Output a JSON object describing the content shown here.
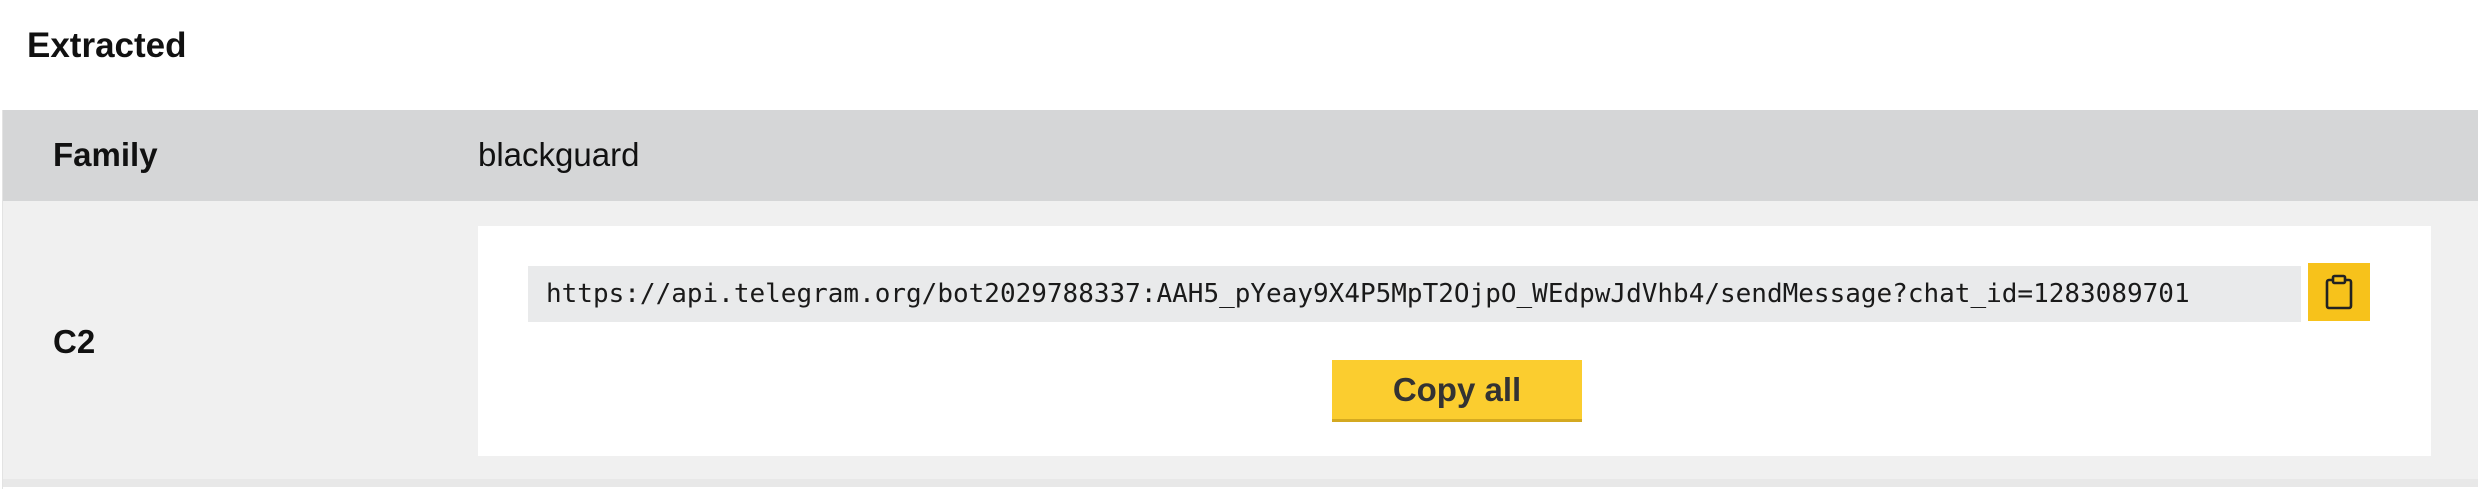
{
  "section": {
    "title": "Extracted"
  },
  "rows": [
    {
      "key": "Family",
      "value": "blackguard"
    },
    {
      "key": "C2",
      "values": [
        "https://api.telegram.org/bot2029788337:AAH5_pYeay9X4P5MpT2OjpO_WEdpwJdVhb4/sendMessage?chat_id=1283089701"
      ]
    }
  ],
  "actions": {
    "copy_all_label": "Copy all",
    "copy_icon": "clipboard-icon"
  },
  "colors": {
    "accent": "#fbcd2f",
    "family_row_bg": "#d5d6d7",
    "c2_row_bg": "#f0f0f0",
    "url_bg": "#e9eaeb"
  }
}
